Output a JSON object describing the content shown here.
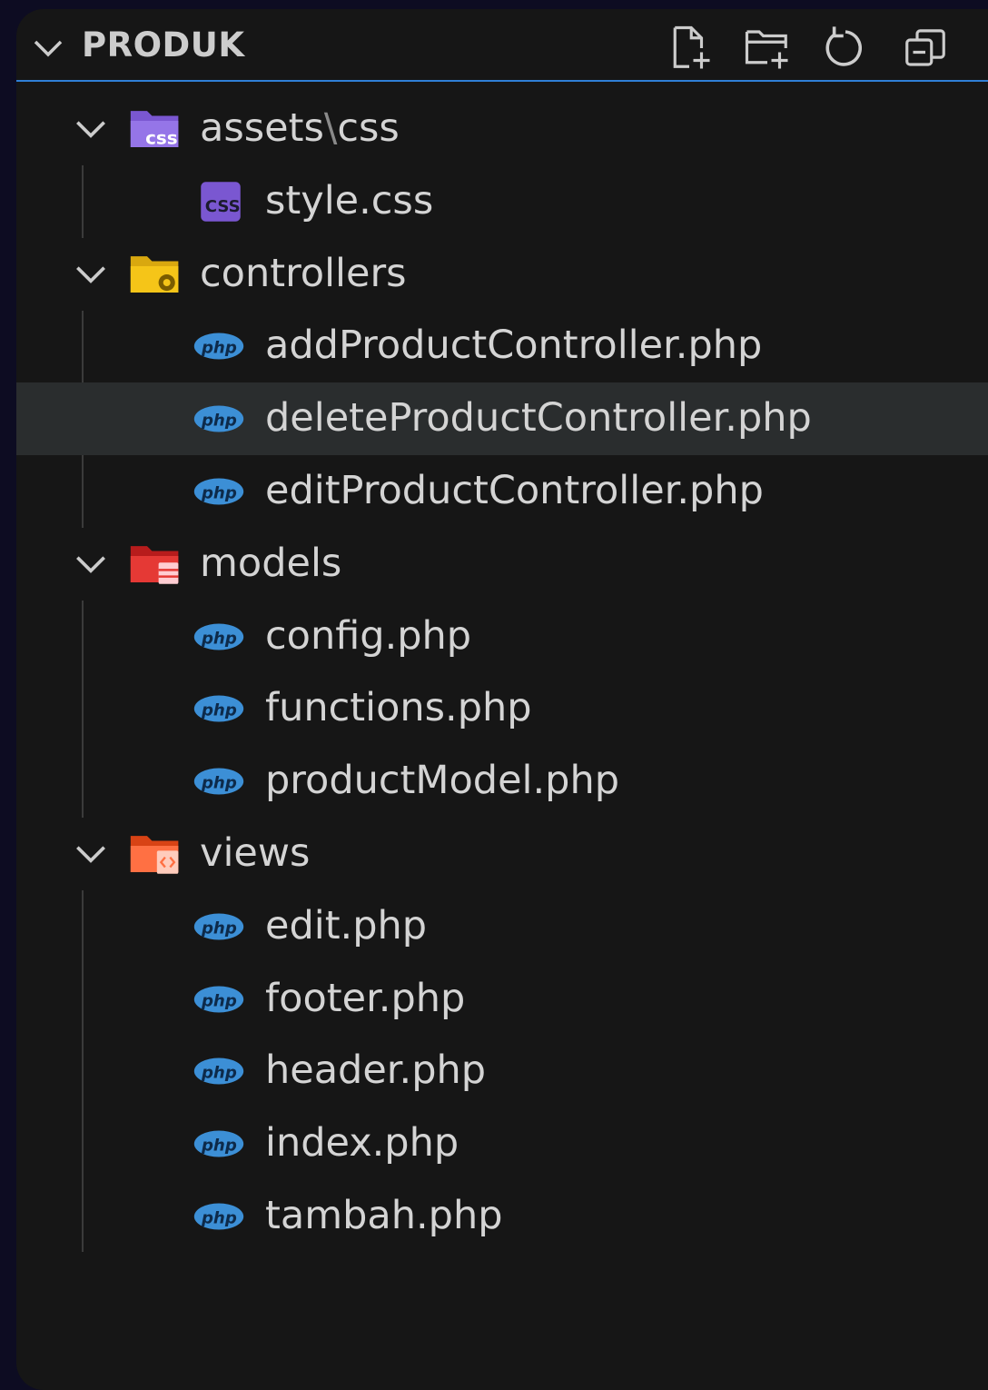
{
  "explorer": {
    "title": "PRODUK",
    "toolbar": [
      {
        "icon": "new-file-icon"
      },
      {
        "icon": "new-folder-icon"
      },
      {
        "icon": "refresh-icon"
      },
      {
        "icon": "collapse-all-icon"
      }
    ]
  },
  "tree": {
    "assets_folder": {
      "name": "assets",
      "sep": "\\",
      "sub": "css"
    },
    "style_css": "style.css",
    "controllers_folder": "controllers",
    "add_controller": "addProductController.php",
    "delete_controller": "deleteProductController.php",
    "edit_controller": "editProductController.php",
    "models_folder": "models",
    "config": "config.php",
    "functions": "functions.php",
    "product_model": "productModel.php",
    "views_folder": "views",
    "edit": "edit.php",
    "footer": "footer.php",
    "header": "header.php",
    "index": "index.php",
    "tambah": "tambah.php"
  },
  "colors": {
    "accent": "#2f7fd6",
    "php": "#3c8fd6",
    "css_folder": "#7a57d1",
    "controllers_folder": "#f5c518",
    "models_folder": "#e53935",
    "views_folder": "#ff7043"
  }
}
